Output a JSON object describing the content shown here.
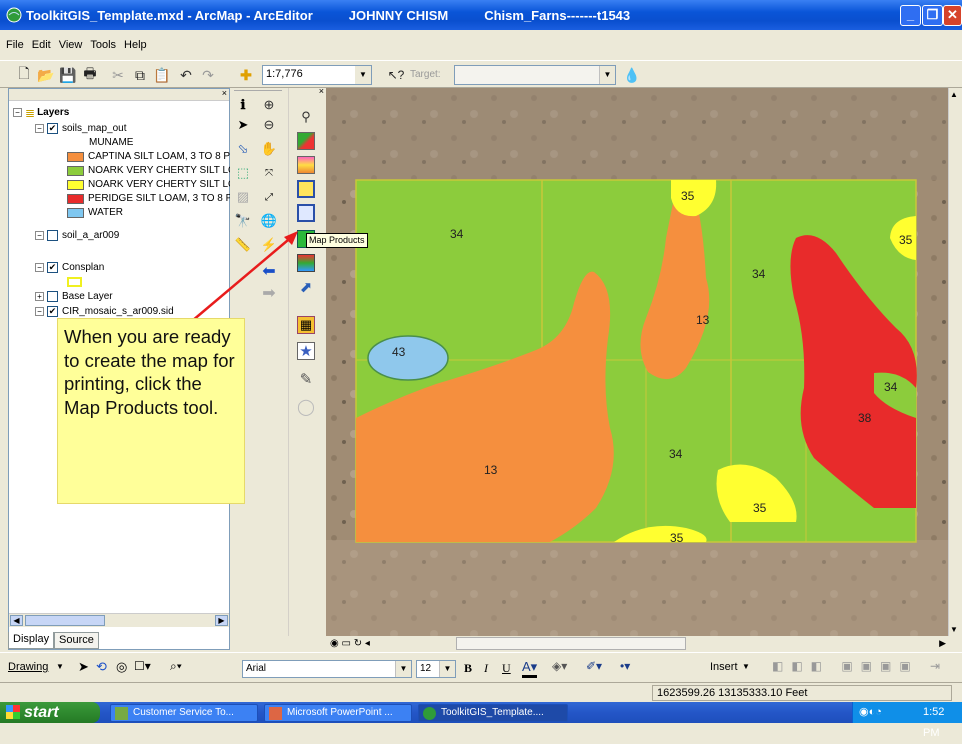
{
  "window": {
    "title": "ToolkitGIS_Template.mxd - ArcMap - ArcEditor",
    "user": "JOHNNY CHISM",
    "document": "Chism_Farns-------t1543"
  },
  "menus": [
    "File",
    "Edit",
    "View",
    "Tools",
    "Help"
  ],
  "toolbar": {
    "scale": "1:7,776",
    "target_label": "Target:"
  },
  "toc": {
    "root": "Layers",
    "layers": [
      {
        "name": "soils_map_out",
        "checked": true,
        "expanded": true
      },
      {
        "name": "soil_a_ar009",
        "checked": false,
        "expanded": true
      },
      {
        "name": "Consplan",
        "checked": true,
        "expanded": true
      },
      {
        "name": "Base Layer",
        "checked": false,
        "expanded": false
      },
      {
        "name": "CIR_mosaic_s_ar009.sid",
        "checked": true,
        "expanded": true
      }
    ],
    "field": "MUNAME",
    "legend": [
      {
        "label": "CAPTINA SILT LOAM, 3 TO 8 P",
        "color": "#f58f3e"
      },
      {
        "label": "NOARK VERY CHERTY SILT LO,",
        "color": "#8ccc3c"
      },
      {
        "label": "NOARK VERY CHERTY SILT LO,",
        "color": "#ffff30"
      },
      {
        "label": "PERIDGE SILT LOAM, 3 TO 8 P",
        "color": "#e82b2b"
      },
      {
        "label": "WATER",
        "color": "#7fc7f0"
      }
    ],
    "tabs": [
      "Display",
      "Source"
    ]
  },
  "tooltip": "Map Products",
  "callout": "When you are ready to create the map for printing, click the Map Products tool.",
  "map_labels": [
    "34",
    "35",
    "35",
    "34",
    "13",
    "43",
    "34",
    "38",
    "34",
    "13",
    "35",
    "35"
  ],
  "drawing": {
    "drawing_label": "Drawing",
    "font": "Arial",
    "font_size": "12",
    "insert_label": "Insert"
  },
  "status": {
    "coords": "1623599.26  13135333.10 Feet"
  },
  "taskbar": {
    "start": "start",
    "tasks": [
      "Customer Service To...",
      "Microsoft PowerPoint ...",
      "ToolkitGIS_Template...."
    ],
    "clock": "1:52 PM"
  },
  "colors": {
    "title_bar": "#0a55d8",
    "callout_bg": "#ffff99",
    "arrow": "#e81c1c"
  }
}
